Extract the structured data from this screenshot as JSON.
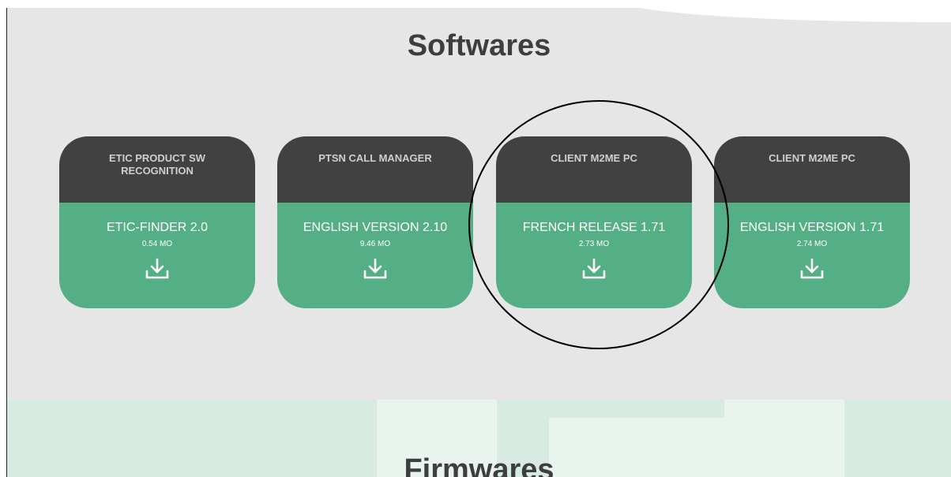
{
  "softwares": {
    "title": "Softwares",
    "cards": [
      {
        "header": "ETIC PRODUCT SW RECOGNITION",
        "version": "ETIC-FINDER 2.0",
        "size": "0.54 MO",
        "icon": "download-icon"
      },
      {
        "header": "PTSN CALL MANAGER",
        "version": "ENGLISH VERSION 2.10",
        "size": "9.46 MO",
        "icon": "download-icon"
      },
      {
        "header": "CLIENT M2ME PC",
        "version": "FRENCH RELEASE 1.71",
        "size": "2.73 MO",
        "icon": "download-icon"
      },
      {
        "header": "CLIENT M2ME PC",
        "version": "ENGLISH VERSION 1.71",
        "size": "2.74 MO",
        "icon": "download-icon"
      }
    ]
  },
  "firmwares": {
    "title": "Firmwares"
  },
  "colors": {
    "section_bg": "#e6e6e6",
    "card_header_bg": "#414141",
    "card_body_bg": "#54ae86",
    "firmwares_bg": "#d7ebe3"
  }
}
